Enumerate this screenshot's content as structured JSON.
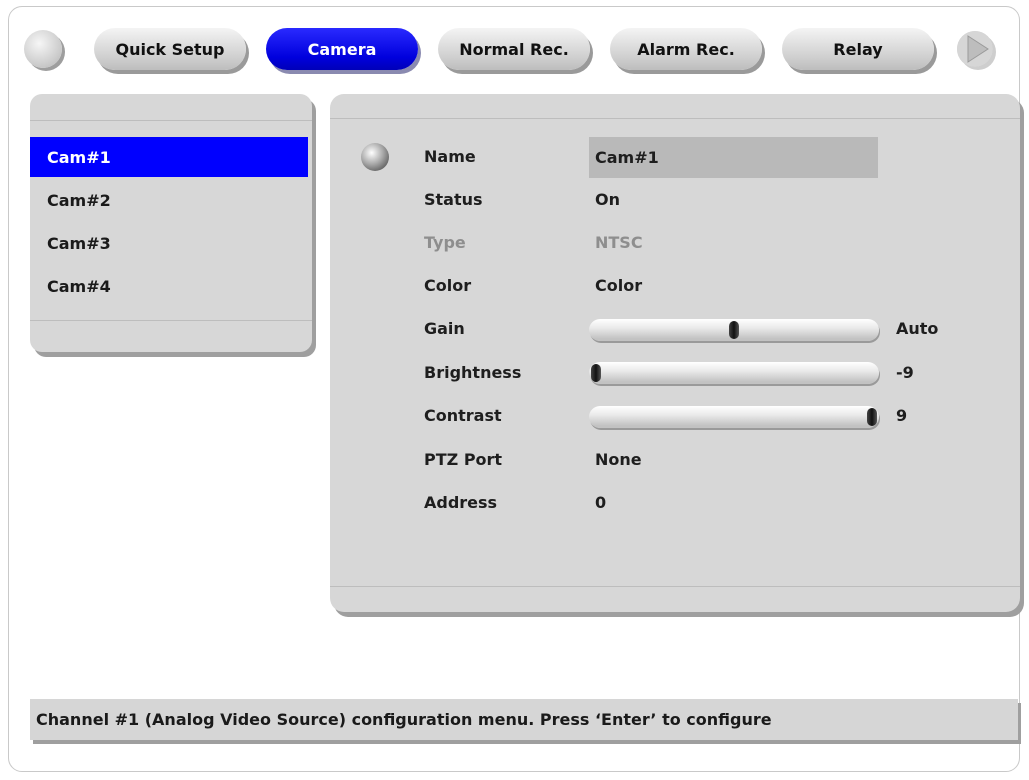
{
  "tabs": [
    {
      "label": "Quick Setup",
      "active": false
    },
    {
      "label": "Camera",
      "active": true
    },
    {
      "label": "Normal Rec.",
      "active": false
    },
    {
      "label": "Alarm Rec.",
      "active": false
    },
    {
      "label": "Relay",
      "active": false
    }
  ],
  "cameras": [
    {
      "label": "Cam#1",
      "selected": true
    },
    {
      "label": "Cam#2",
      "selected": false
    },
    {
      "label": "Cam#3",
      "selected": false
    },
    {
      "label": "Cam#4",
      "selected": false
    }
  ],
  "settings": {
    "name": {
      "label": "Name",
      "value": "Cam#1"
    },
    "status": {
      "label": "Status",
      "value": "On"
    },
    "type": {
      "label": "Type",
      "value": "NTSC",
      "disabled": true
    },
    "color": {
      "label": "Color",
      "value": "Color"
    },
    "gain": {
      "label": "Gain",
      "value": "Auto",
      "level": 0.5
    },
    "brightness": {
      "label": "Brightness",
      "value": "-9",
      "level": 0.0
    },
    "contrast": {
      "label": "Contrast",
      "value": "9",
      "level": 1.0
    },
    "ptz_port": {
      "label": "PTZ Port",
      "value": "None"
    },
    "address": {
      "label": "Address",
      "value": "0"
    }
  },
  "status_bar": {
    "text": "Channel #1 (Analog Video Source) configuration menu. Press ‘Enter’ to configure"
  },
  "colors": {
    "accent": "#0000ff",
    "panel": "#d7d7d7"
  }
}
